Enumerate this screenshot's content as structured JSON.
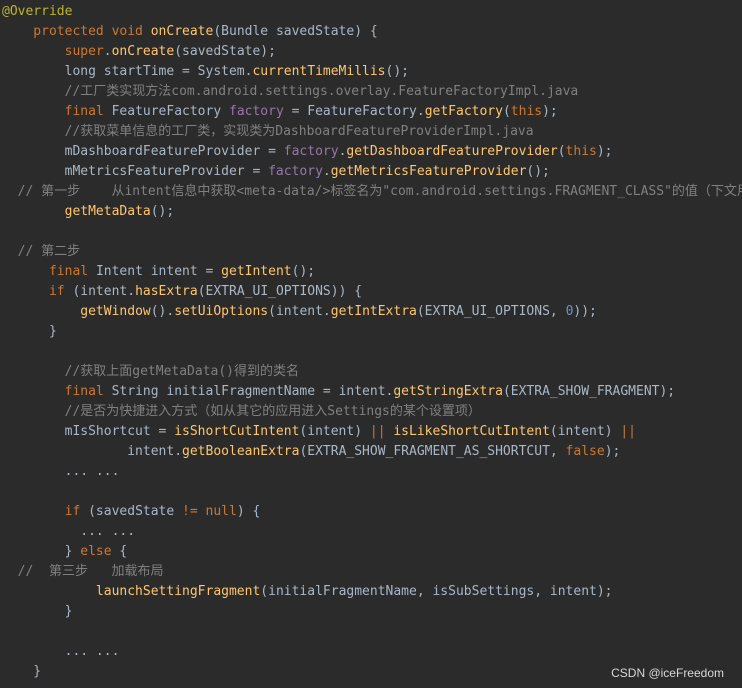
{
  "editor": {
    "lines": [
      [
        {
          "t": "@Override",
          "c": "ann"
        }
      ],
      [
        {
          "t": "    protected ",
          "c": "kw"
        },
        {
          "t": "void ",
          "c": "kw"
        },
        {
          "t": "onCreate",
          "c": "fn"
        },
        {
          "t": "(Bundle savedState) {",
          "c": "plain"
        }
      ],
      [
        {
          "t": "        ",
          "c": "plain"
        },
        {
          "t": "super",
          "c": "kw"
        },
        {
          "t": ".",
          "c": "plain"
        },
        {
          "t": "onCreate",
          "c": "mc"
        },
        {
          "t": "(savedState);",
          "c": "plain"
        }
      ],
      [
        {
          "t": "        long startTime = System.",
          "c": "plain"
        },
        {
          "t": "currentTimeMillis",
          "c": "mc"
        },
        {
          "t": "();",
          "c": "plain"
        }
      ],
      [
        {
          "t": "        //工厂类实现方法com.android.settings.overlay.FeatureFactoryImpl.java",
          "c": "com"
        }
      ],
      [
        {
          "t": "        ",
          "c": "plain"
        },
        {
          "t": "final ",
          "c": "kw"
        },
        {
          "t": "FeatureFactory ",
          "c": "plain"
        },
        {
          "t": "factory",
          "c": "field"
        },
        {
          "t": " = FeatureFactory.",
          "c": "plain"
        },
        {
          "t": "getFactory",
          "c": "mc"
        },
        {
          "t": "(",
          "c": "plain"
        },
        {
          "t": "this",
          "c": "kw"
        },
        {
          "t": ");",
          "c": "plain"
        }
      ],
      [
        {
          "t": "        //获取菜单信息的工厂类，实现类为DashboardFeatureProviderImpl.java",
          "c": "com"
        }
      ],
      [
        {
          "t": "        mDashboardFeatureProvider = ",
          "c": "plain"
        },
        {
          "t": "factory",
          "c": "field"
        },
        {
          "t": ".",
          "c": "plain"
        },
        {
          "t": "getDashboardFeatureProvider",
          "c": "mc"
        },
        {
          "t": "(",
          "c": "plain"
        },
        {
          "t": "this",
          "c": "kw"
        },
        {
          "t": ");",
          "c": "plain"
        }
      ],
      [
        {
          "t": "        mMetricsFeatureProvider = ",
          "c": "plain"
        },
        {
          "t": "factory",
          "c": "field"
        },
        {
          "t": ".",
          "c": "plain"
        },
        {
          "t": "getMetricsFeatureProvider",
          "c": "mc"
        },
        {
          "t": "();",
          "c": "plain"
        }
      ],
      [
        {
          "t": "  // 第一步    从intent信息中获取<meta-data/>标签名为\"com.android.settings.FRAGMENT_CLASS\"的值（下文用于",
          "c": "com"
        }
      ],
      [
        {
          "t": "        ",
          "c": "plain"
        },
        {
          "t": "getMetaData",
          "c": "mc"
        },
        {
          "t": "();",
          "c": "plain"
        }
      ],
      [
        {
          "t": "",
          "c": "plain"
        }
      ],
      [
        {
          "t": "  // 第二步",
          "c": "com"
        }
      ],
      [
        {
          "t": "      ",
          "c": "plain"
        },
        {
          "t": "final ",
          "c": "kw"
        },
        {
          "t": "Intent intent = ",
          "c": "plain"
        },
        {
          "t": "getIntent",
          "c": "mc"
        },
        {
          "t": "();",
          "c": "plain"
        }
      ],
      [
        {
          "t": "      ",
          "c": "plain"
        },
        {
          "t": "if ",
          "c": "kw"
        },
        {
          "t": "(intent.",
          "c": "plain"
        },
        {
          "t": "hasExtra",
          "c": "mc"
        },
        {
          "t": "(EXTRA_UI_OPTIONS)) {",
          "c": "plain"
        }
      ],
      [
        {
          "t": "          ",
          "c": "plain"
        },
        {
          "t": "getWindow",
          "c": "mc"
        },
        {
          "t": "().",
          "c": "plain"
        },
        {
          "t": "setUiOptions",
          "c": "mc"
        },
        {
          "t": "(intent.",
          "c": "plain"
        },
        {
          "t": "getIntExtra",
          "c": "mc"
        },
        {
          "t": "(EXTRA_UI_OPTIONS, ",
          "c": "plain"
        },
        {
          "t": "0",
          "c": "num"
        },
        {
          "t": "));",
          "c": "plain"
        }
      ],
      [
        {
          "t": "      }",
          "c": "plain"
        }
      ],
      [
        {
          "t": "",
          "c": "plain"
        }
      ],
      [
        {
          "t": "        //获取上面getMetaData()得到的类名",
          "c": "com"
        }
      ],
      [
        {
          "t": "        ",
          "c": "plain"
        },
        {
          "t": "final ",
          "c": "kw"
        },
        {
          "t": "String initialFragmentName = intent.",
          "c": "plain"
        },
        {
          "t": "getStringExtra",
          "c": "mc"
        },
        {
          "t": "(EXTRA_SHOW_FRAGMENT);",
          "c": "plain"
        }
      ],
      [
        {
          "t": "        //是否为快捷进入方式（如从其它的应用进入Settings的某个设置项）",
          "c": "com"
        }
      ],
      [
        {
          "t": "        mIsShortcut = ",
          "c": "plain"
        },
        {
          "t": "isShortCutIntent",
          "c": "mc"
        },
        {
          "t": "(intent) ",
          "c": "plain"
        },
        {
          "t": "|| ",
          "c": "kw"
        },
        {
          "t": "isLikeShortCutIntent",
          "c": "mc"
        },
        {
          "t": "(intent) ",
          "c": "plain"
        },
        {
          "t": "||",
          "c": "kw"
        }
      ],
      [
        {
          "t": "                ",
          "c": "plain"
        },
        {
          "t": "intent.",
          "c": "plain"
        },
        {
          "t": "getBooleanExtra",
          "c": "mc"
        },
        {
          "t": "(EXTRA_SHOW_FRAGMENT_AS_SHORTCUT, ",
          "c": "plain"
        },
        {
          "t": "false",
          "c": "kw"
        },
        {
          "t": ");",
          "c": "plain"
        }
      ],
      [
        {
          "t": "        ... ...",
          "c": "plain"
        }
      ],
      [
        {
          "t": "",
          "c": "plain"
        }
      ],
      [
        {
          "t": "        ",
          "c": "plain"
        },
        {
          "t": "if ",
          "c": "kw"
        },
        {
          "t": "(savedState ",
          "c": "plain"
        },
        {
          "t": "!= ",
          "c": "kw"
        },
        {
          "t": "null",
          "c": "kw"
        },
        {
          "t": ") {",
          "c": "plain"
        }
      ],
      [
        {
          "t": "          ... ...",
          "c": "plain"
        }
      ],
      [
        {
          "t": "        } ",
          "c": "plain"
        },
        {
          "t": "else ",
          "c": "kw"
        },
        {
          "t": "{",
          "c": "plain"
        }
      ],
      [
        {
          "t": "  //  第三步   加载布局",
          "c": "com"
        }
      ],
      [
        {
          "t": "            ",
          "c": "plain"
        },
        {
          "t": "launchSettingFragment",
          "c": "mc"
        },
        {
          "t": "(initialFragmentName, isSubSettings, intent);",
          "c": "plain"
        }
      ],
      [
        {
          "t": "        }",
          "c": "plain"
        }
      ],
      [
        {
          "t": "",
          "c": "plain"
        }
      ],
      [
        {
          "t": "        ... ...",
          "c": "plain"
        }
      ],
      [
        {
          "t": "    }",
          "c": "plain"
        }
      ]
    ]
  },
  "watermark": "CSDN @iceFreedom"
}
